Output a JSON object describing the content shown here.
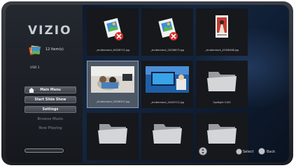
{
  "brand": {
    "logo_text": "VIZIO"
  },
  "device": {
    "items_count": "12 Item(s)",
    "source": "USB 1",
    "icon": "photo-stack-icon"
  },
  "menu": {
    "main_menu": "Main Menu",
    "start_slide_show": "Start Slide Show",
    "settings": "Settings",
    "browse_music": "Browse Music",
    "now_playing": "Now Playing"
  },
  "grid": {
    "tiles": [
      {
        "label": "_shutterstock_64328722.jpg",
        "type": "broken-image"
      },
      {
        "label": "_shutterstock_18238875.jpg",
        "type": "broken-image"
      },
      {
        "label": "_shutterstock_45308488.jpg",
        "type": "poster"
      },
      {
        "label": "_shutterstock_55938337.jpg",
        "type": "photo-couple",
        "selected": true
      },
      {
        "label": "_shutterstock_34329722.jpg",
        "type": "photo-tv"
      },
      {
        "label": "Spotlight V100",
        "type": "folder"
      },
      {
        "label": "",
        "type": "folder"
      },
      {
        "label": "",
        "type": "folder"
      },
      {
        "label": "",
        "type": "folder"
      }
    ]
  },
  "controls": {
    "select_label": "Select",
    "back_label": "Back"
  },
  "colors": {
    "accent": "#8fa0b5",
    "screen_bg": "#14263f",
    "error_red": "#d9302c"
  }
}
